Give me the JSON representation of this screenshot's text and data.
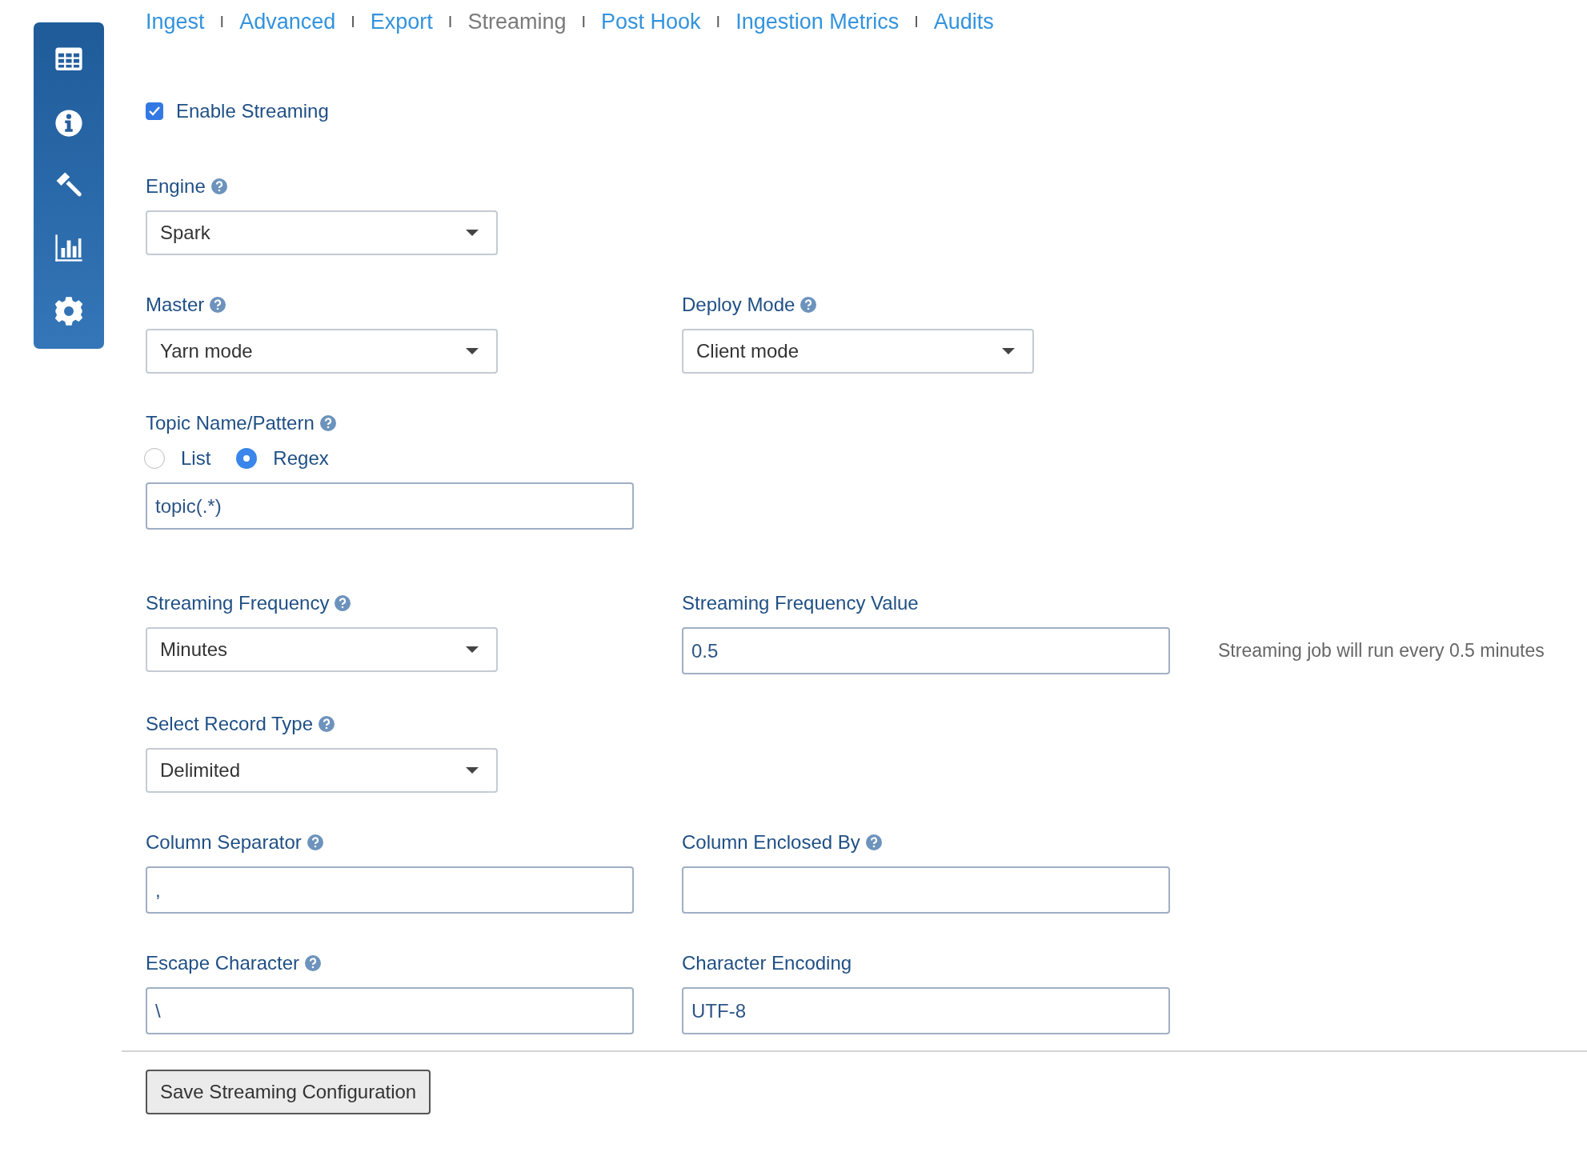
{
  "sidebar": {
    "items": [
      {
        "kind": "table"
      },
      {
        "kind": "info"
      },
      {
        "kind": "hammer"
      },
      {
        "kind": "chart"
      },
      {
        "kind": "gear"
      }
    ]
  },
  "tabs": [
    {
      "label": "Ingest",
      "selected": false
    },
    {
      "label": "Advanced",
      "selected": false
    },
    {
      "label": "Export",
      "selected": false
    },
    {
      "label": "Streaming",
      "selected": true
    },
    {
      "label": "Post Hook",
      "selected": false
    },
    {
      "label": "Ingestion Metrics",
      "selected": false
    },
    {
      "label": "Audits",
      "selected": false
    }
  ],
  "tab_separators": [
    "I",
    "I",
    "I",
    "I",
    "I",
    "I"
  ],
  "enable_streaming": {
    "label": "Enable Streaming",
    "checked": true
  },
  "rows": [
    [
      {
        "label": "Engine",
        "help": true,
        "kind": "select",
        "value": "Spark"
      }
    ],
    [
      {
        "label": "Master",
        "help": true,
        "kind": "select",
        "value": "Yarn mode"
      },
      {
        "label": "Deploy Mode",
        "help": true,
        "kind": "select",
        "value": "Client mode"
      }
    ],
    [
      {
        "label": "Topic Name/Pattern",
        "help": true,
        "kind": "radio_text",
        "options": [
          {
            "label": "List",
            "selected": false
          },
          {
            "label": "Regex",
            "selected": true
          }
        ],
        "value": "topic(.*)"
      }
    ],
    [
      {
        "label": "Streaming Frequency",
        "help": true,
        "kind": "select",
        "value": "Minutes"
      },
      {
        "label": "Streaming Frequency Value",
        "help": false,
        "kind": "text",
        "value": "0.5",
        "note": "Streaming job will run every 0.5 minutes"
      }
    ],
    [
      {
        "label": "Select Record Type",
        "help": true,
        "kind": "select",
        "value": "Delimited"
      }
    ],
    [
      {
        "label": "Column Separator",
        "help": true,
        "kind": "text",
        "value": ","
      },
      {
        "label": "Column Enclosed By",
        "help": true,
        "kind": "text"
      }
    ],
    [
      {
        "label": "Escape Character",
        "help": true,
        "kind": "text",
        "value": "\\"
      },
      {
        "label": "Character Encoding",
        "help": false,
        "kind": "text",
        "value": "UTF-8"
      }
    ]
  ],
  "save_button": {
    "label": "Save Streaming Configuration"
  }
}
